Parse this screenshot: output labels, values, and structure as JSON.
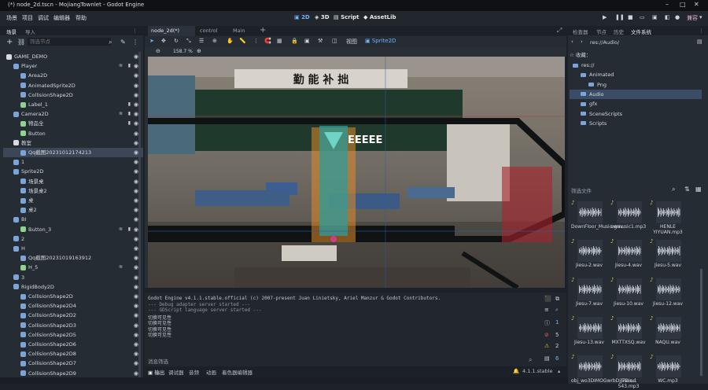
{
  "window": {
    "title": "(*) node_2d.tscn - MojiangTownlet - Godot Engine",
    "controls": [
      "–",
      "□",
      "✕"
    ]
  },
  "menu": [
    "场景",
    "项目",
    "调试",
    "编辑器",
    "帮助"
  ],
  "workspaces": [
    {
      "label": "2D",
      "active": true
    },
    {
      "label": "3D",
      "active": false
    },
    {
      "label": "Script",
      "active": false
    },
    {
      "label": "AssetLib",
      "active": false
    }
  ],
  "renderer": "兼容",
  "left_panel": {
    "tabs": [
      "场景",
      "导入"
    ],
    "filter_placeholder": "筛选节点",
    "nodes": [
      {
        "label": "GAME_DEMO",
        "indent": 0,
        "color": "#d8dce2",
        "signal": false,
        "group": false
      },
      {
        "label": "Player",
        "indent": 1,
        "color": "#7ba4d8",
        "signal": true,
        "group": true
      },
      {
        "label": "Area2D",
        "indent": 2,
        "color": "#7ba4d8",
        "signal": false,
        "group": false
      },
      {
        "label": "AnimatedSprite2D",
        "indent": 2,
        "color": "#7ba4d8",
        "signal": false,
        "group": false
      },
      {
        "label": "CollisionShape2D",
        "indent": 2,
        "color": "#7ba4d8",
        "signal": false,
        "group": false
      },
      {
        "label": "Label_1",
        "indent": 2,
        "color": "#8ed38e",
        "signal": false,
        "group": true
      },
      {
        "label": "Camera2D",
        "indent": 1,
        "color": "#7ba4d8",
        "signal": true,
        "group": true
      },
      {
        "label": "物品全",
        "indent": 2,
        "color": "#8ed38e",
        "signal": false,
        "group": true
      },
      {
        "label": "Button",
        "indent": 2,
        "color": "#8ed38e",
        "signal": false,
        "group": false
      },
      {
        "label": "教室",
        "indent": 1,
        "color": "#d8dce2",
        "signal": false,
        "group": false
      },
      {
        "label": "Qq截图20231012174213",
        "indent": 2,
        "color": "#7ba4d8",
        "signal": false,
        "group": false,
        "selected": true
      },
      {
        "label": "1",
        "indent": 1,
        "color": "#7ba4d8",
        "signal": false,
        "group": false
      },
      {
        "label": "Sprite2D",
        "indent": 1,
        "color": "#7ba4d8",
        "signal": false,
        "group": false
      },
      {
        "label": "场景桌",
        "indent": 2,
        "color": "#7ba4d8",
        "signal": false,
        "group": false
      },
      {
        "label": "场景桌2",
        "indent": 2,
        "color": "#7ba4d8",
        "signal": false,
        "group": false
      },
      {
        "label": "桌",
        "indent": 2,
        "color": "#7ba4d8",
        "signal": false,
        "group": false
      },
      {
        "label": "桌2",
        "indent": 2,
        "color": "#7ba4d8",
        "signal": false,
        "group": false
      },
      {
        "label": "BI",
        "indent": 1,
        "color": "#7ba4d8",
        "signal": false,
        "group": false
      },
      {
        "label": "Button_3",
        "indent": 2,
        "color": "#8ed38e",
        "signal": true,
        "group": true
      },
      {
        "label": "2",
        "indent": 1,
        "color": "#7ba4d8",
        "signal": false,
        "group": false
      },
      {
        "label": "H",
        "indent": 1,
        "color": "#7ba4d8",
        "signal": false,
        "group": false
      },
      {
        "label": "Qq截图20231019163912",
        "indent": 2,
        "color": "#7ba4d8",
        "signal": false,
        "group": false
      },
      {
        "label": "H_5",
        "indent": 2,
        "color": "#8ed38e",
        "signal": true,
        "group": false
      },
      {
        "label": "3",
        "indent": 1,
        "color": "#7ba4d8",
        "signal": false,
        "group": false
      },
      {
        "label": "RigidBody2D",
        "indent": 1,
        "color": "#7ba4d8",
        "signal": false,
        "group": false
      },
      {
        "label": "CollisionShape2D",
        "indent": 2,
        "color": "#7ba4d8",
        "signal": false,
        "group": false
      },
      {
        "label": "CollisionShape2D4",
        "indent": 2,
        "color": "#7ba4d8",
        "signal": false,
        "group": false
      },
      {
        "label": "CollisionShape2D2",
        "indent": 2,
        "color": "#7ba4d8",
        "signal": false,
        "group": false
      },
      {
        "label": "CollisionShape2D3",
        "indent": 2,
        "color": "#7ba4d8",
        "signal": false,
        "group": false
      },
      {
        "label": "CollisionShape2D5",
        "indent": 2,
        "color": "#7ba4d8",
        "signal": false,
        "group": false
      },
      {
        "label": "CollisionShape2D6",
        "indent": 2,
        "color": "#7ba4d8",
        "signal": false,
        "group": false
      },
      {
        "label": "CollisionShape2D8",
        "indent": 2,
        "color": "#7ba4d8",
        "signal": false,
        "group": false
      },
      {
        "label": "CollisionShape2D7",
        "indent": 2,
        "color": "#7ba4d8",
        "signal": false,
        "group": false
      },
      {
        "label": "CollisionShape2D9",
        "indent": 2,
        "color": "#7ba4d8",
        "signal": false,
        "group": false
      }
    ]
  },
  "editor_tabs": [
    {
      "label": "node_2d(*)",
      "active": true
    },
    {
      "label": "control",
      "active": false
    },
    {
      "label": "Main",
      "active": false
    }
  ],
  "toolbar": {
    "view_label": "视图",
    "sprite_label": "Sprite2D"
  },
  "viewport": {
    "zoom": "158.7 %",
    "label_text": "EEEEE",
    "banner": "勤 能 补 拙"
  },
  "console": {
    "lines": [
      "Godot Engine v4.1.1.stable.official (c) 2007-present Juan Linietsky, Ariel Manzur & Godot Contributors.",
      "--- Debug adapter server started ---",
      "--- GDScript language server started ---",
      "切换可见性",
      "切换可见性",
      "切换可见性",
      "切换可见性"
    ],
    "filter_placeholder": "消息筛选",
    "counts": [
      "1",
      "5",
      "2",
      "6"
    ]
  },
  "bottom_tabs": [
    "输出",
    "调试器",
    "音频",
    "动画",
    "着色器编辑器"
  ],
  "version": "4.1.1.stable",
  "right_panel": {
    "tabs": [
      {
        "label": "检查器",
        "active": false
      },
      {
        "label": "节点",
        "active": false
      },
      {
        "label": "历史",
        "active": false
      },
      {
        "label": "文件系统",
        "active": true
      }
    ],
    "path": "res://Audio/",
    "favorites_label": "收藏：",
    "tree": [
      {
        "label": "res://",
        "indent": 0
      },
      {
        "label": "Animated",
        "indent": 1
      },
      {
        "label": "Png",
        "indent": 2
      },
      {
        "label": "Audio",
        "indent": 1,
        "selected": true
      },
      {
        "label": "gfx",
        "indent": 1
      },
      {
        "label": "SceneScripts",
        "indent": 1
      },
      {
        "label": "Scripts",
        "indent": 1
      }
    ],
    "filter_placeholder": "筛选文件",
    "files": [
      {
        "label": "DownFloor_Music.wav",
        "audio": true
      },
      {
        "label": "egmusic1.mp3",
        "audio": true
      },
      {
        "label": "HENLE YIYUAN.mp3",
        "audio": true
      },
      {
        "label": "Jiesu-2.wav",
        "audio": true
      },
      {
        "label": "Jiesu-4.wav",
        "audio": true
      },
      {
        "label": "Jiesu-5.wav",
        "audio": true
      },
      {
        "label": "Jiesu-7.wav",
        "audio": true
      },
      {
        "label": "Jiesu-10.wav",
        "audio": true
      },
      {
        "label": "Jiesu-12.wav",
        "audio": true
      },
      {
        "label": "Jiesu-13.wav",
        "audio": true
      },
      {
        "label": "MXTTXSQ.wav",
        "audio": true
      },
      {
        "label": "NAQU.wav",
        "audio": true
      },
      {
        "label": "obj_wo3DIMOGwrbDjj7Dis...",
        "audio": true
      },
      {
        "label": "Sound 543.mp3",
        "audio": true
      },
      {
        "label": "WC.mp3",
        "audio": true
      }
    ]
  }
}
